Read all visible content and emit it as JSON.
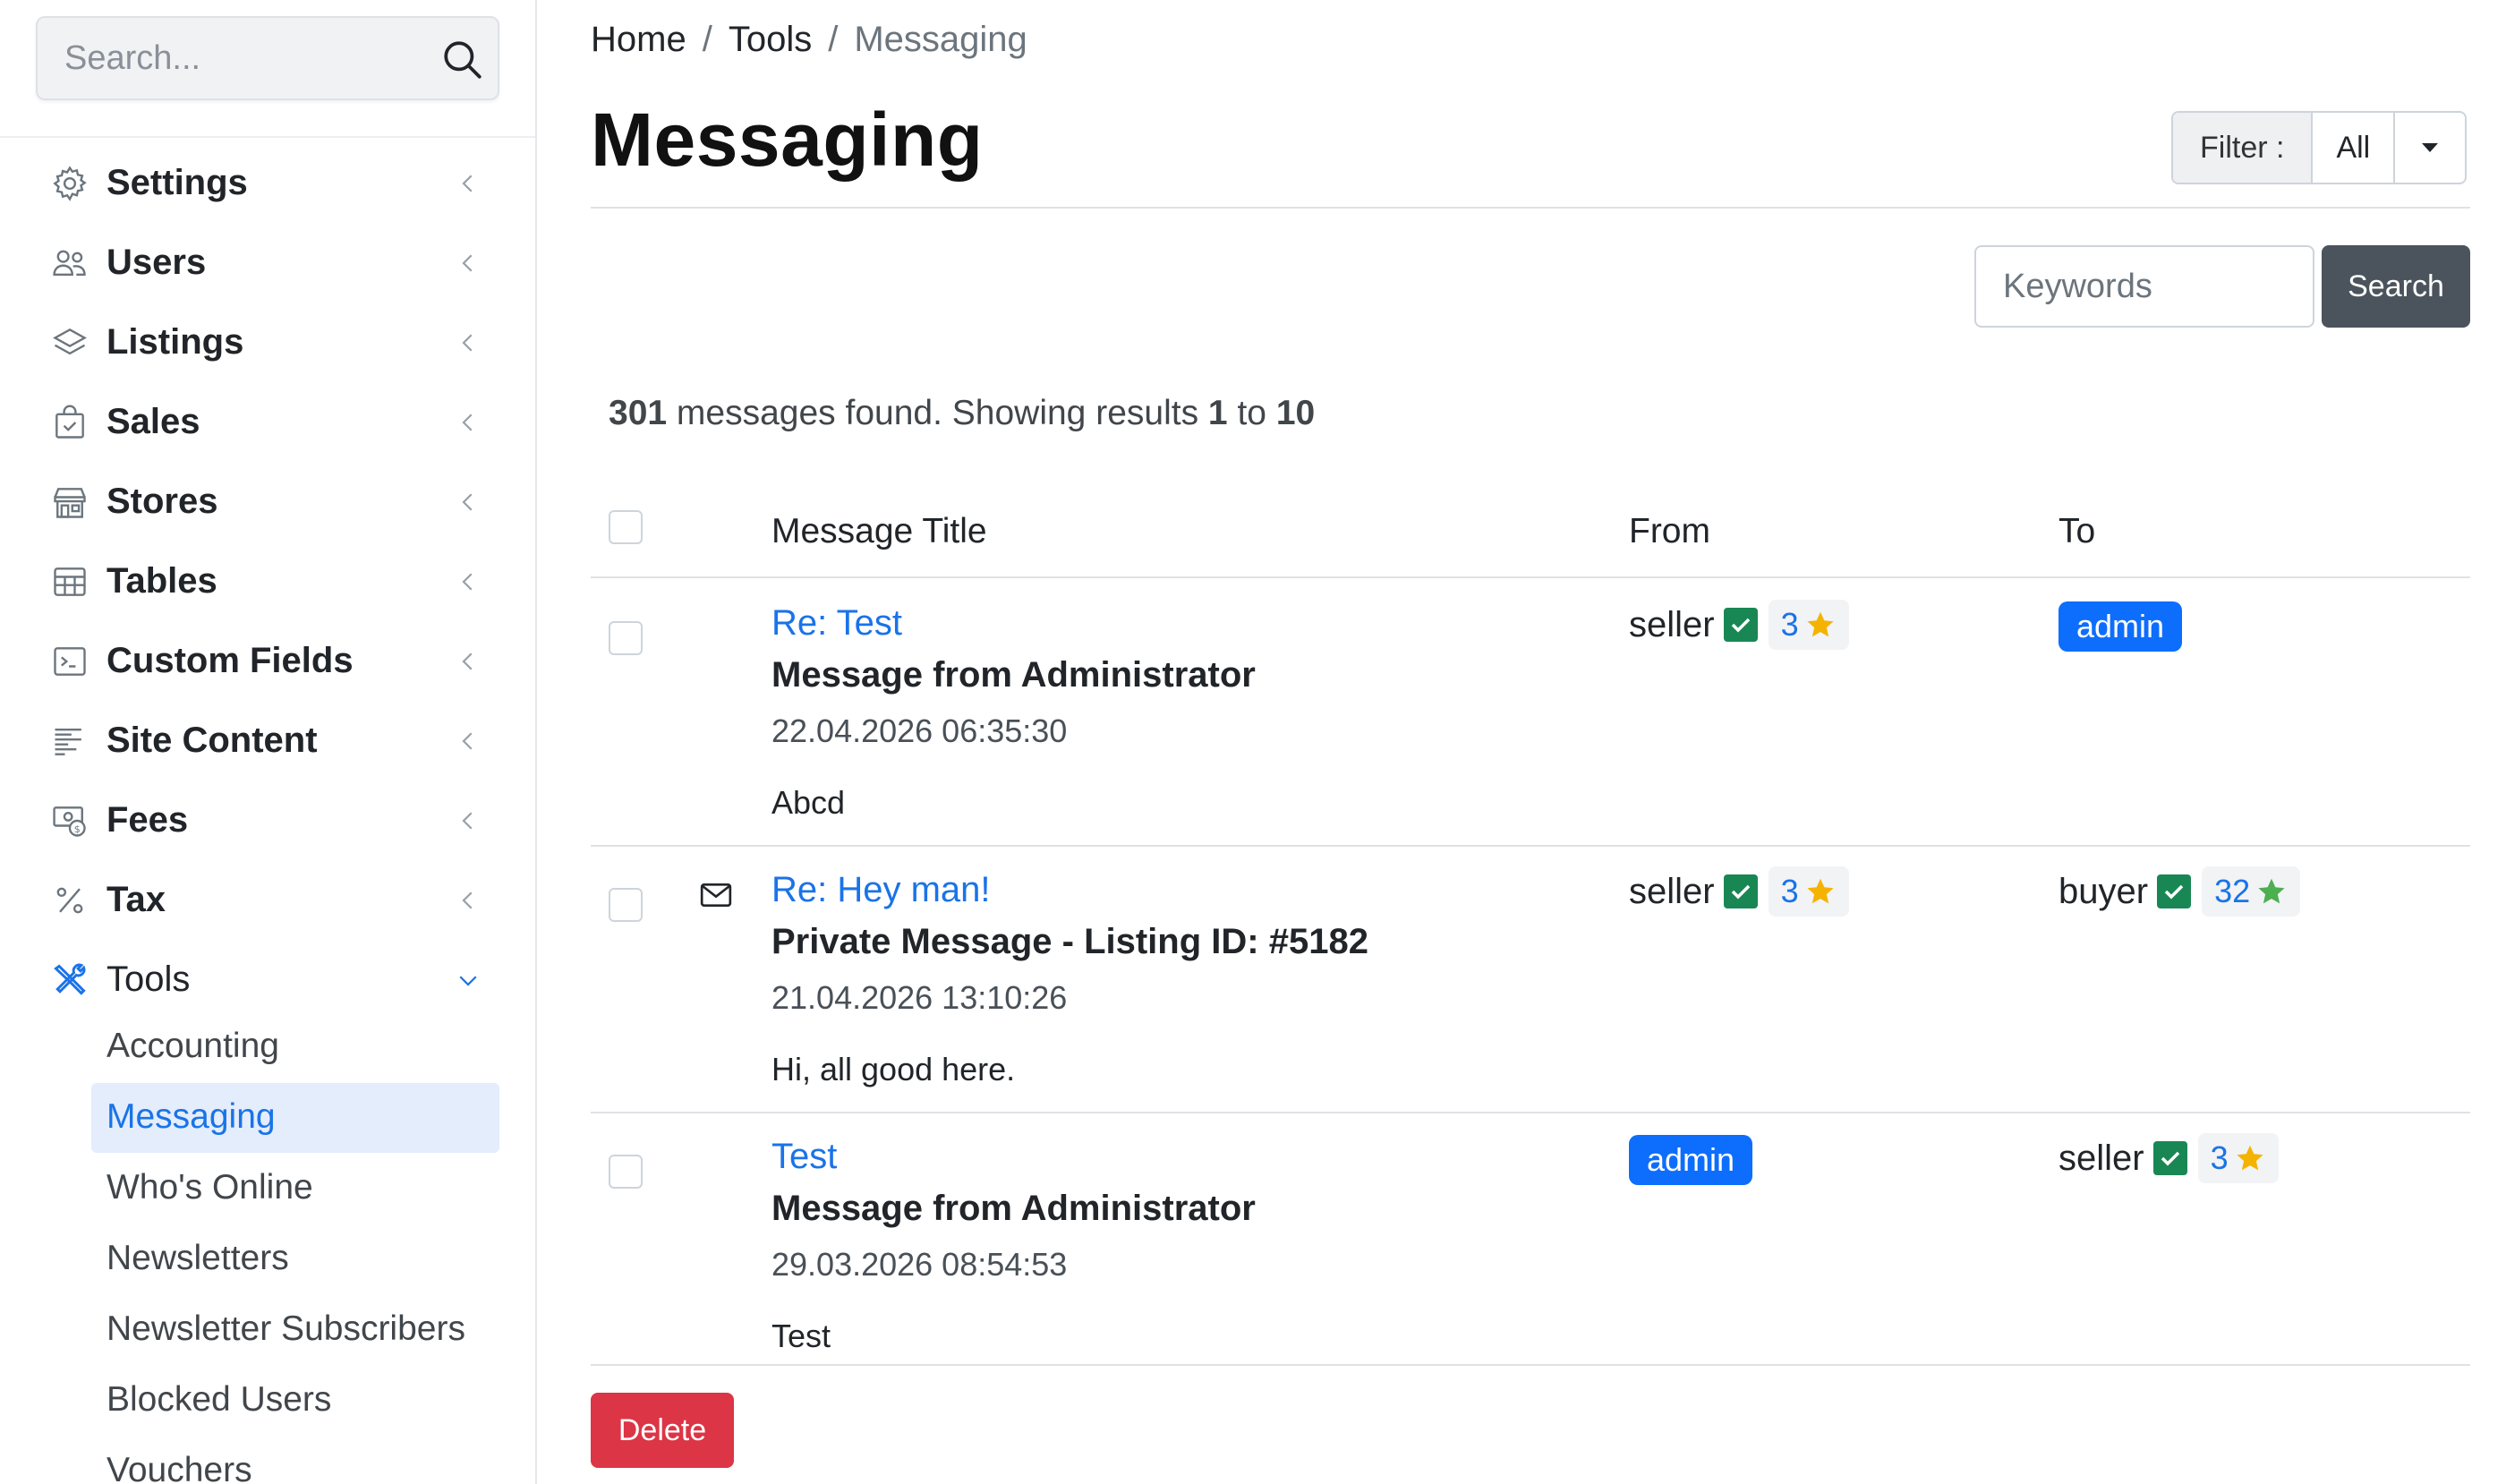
{
  "sidebar": {
    "search_placeholder": "Search...",
    "items": [
      {
        "label": "Settings",
        "icon": "gear-icon"
      },
      {
        "label": "Users",
        "icon": "users-icon"
      },
      {
        "label": "Listings",
        "icon": "layers-icon"
      },
      {
        "label": "Sales",
        "icon": "bag-check-icon"
      },
      {
        "label": "Stores",
        "icon": "shop-icon"
      },
      {
        "label": "Tables",
        "icon": "table-icon"
      },
      {
        "label": "Custom Fields",
        "icon": "terminal-icon"
      },
      {
        "label": "Site Content",
        "icon": "text-align-icon"
      },
      {
        "label": "Fees",
        "icon": "cash-coin-icon"
      },
      {
        "label": "Tax",
        "icon": "percent-icon"
      },
      {
        "label": "Tools",
        "icon": "tools-icon",
        "expanded": true
      }
    ],
    "sub_items": [
      {
        "label": "Accounting"
      },
      {
        "label": "Messaging",
        "active": true
      },
      {
        "label": "Who's Online"
      },
      {
        "label": "Newsletters"
      },
      {
        "label": "Newsletter Subscribers"
      },
      {
        "label": "Blocked Users"
      },
      {
        "label": "Vouchers"
      }
    ]
  },
  "breadcrumb": [
    "Home",
    "Tools",
    "Messaging"
  ],
  "page": {
    "title": "Messaging"
  },
  "filter": {
    "label": "Filter :",
    "value": "All"
  },
  "search": {
    "keywords_placeholder": "Keywords",
    "button": "Search"
  },
  "results": {
    "total": "301",
    "text_mid": "messages found. Showing results",
    "from": "1",
    "to_word": "to",
    "to": "10"
  },
  "table": {
    "headers": [
      "Message Title",
      "From",
      "To"
    ],
    "rows": [
      {
        "title": "Re: Test",
        "subject": "Message from Administrator",
        "date": "22.04.2026 06:35:30",
        "body": "Abcd",
        "from": {
          "type": "user",
          "name": "seller",
          "score": "3",
          "star_color": "#f5b301"
        },
        "to": {
          "type": "badge",
          "name": "admin"
        }
      },
      {
        "title": "Re: Hey man!",
        "subject": "Private Message - Listing ID: #5182",
        "date": "21.04.2026 13:10:26",
        "body": "Hi, all good here.",
        "unread": true,
        "from": {
          "type": "user",
          "name": "seller",
          "score": "3",
          "star_color": "#f5b301"
        },
        "to": {
          "type": "user",
          "name": "buyer",
          "score": "32",
          "star_color": "#4caf50"
        }
      },
      {
        "title": "Test",
        "subject": "Message from Administrator",
        "date": "29.03.2026 08:54:53",
        "body": "Test",
        "from": {
          "type": "badge",
          "name": "admin"
        },
        "to": {
          "type": "user",
          "name": "seller",
          "score": "3",
          "star_color": "#f5b301"
        }
      }
    ]
  },
  "actions": {
    "delete": "Delete"
  },
  "colors": {
    "accent": "#1a73e8",
    "badge": "#0d6efd",
    "danger": "#dc3545",
    "verified": "#198754",
    "search_btn": "#4b545c"
  }
}
